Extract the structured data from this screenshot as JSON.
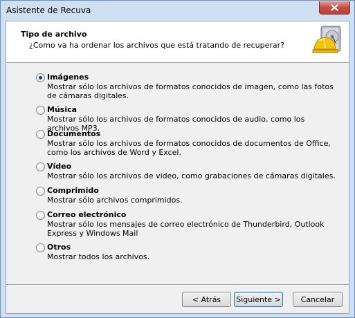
{
  "window": {
    "title": "Asistente de Recuva"
  },
  "header": {
    "title": "Tipo de archivo",
    "subtitle": "¿Como va ha ordenar los archivos que está tratando de recuperar?",
    "icon": "recuva-hard-hat-drive-icon"
  },
  "options": [
    {
      "label": "Imágenes",
      "description": "Mostrar sólo los archivos de formatos conocidos de imagen, como las fotos de cámaras digitales.",
      "checked": true
    },
    {
      "label": "Música",
      "description": "Mostrar sólo los archivos de formatos conocidos de audio, como los archivos MP3.",
      "checked": false
    },
    {
      "label": "Documentos",
      "description": "Mostrar sólo los archivos de formatos conocidos de documentos de Office, como los archivos de Word y Excel.",
      "checked": false
    },
    {
      "label": "Vídeo",
      "description": "Mostrar sólo los archivos de video, como grabaciones de cámaras digitales.",
      "checked": false
    },
    {
      "label": "Comprimido",
      "description": "Mostrar sólo archivos comprimidos.",
      "checked": false
    },
    {
      "label": "Correo electrónico",
      "description": "Mostrar sólo los mensajes de correo electrónico de Thunderbird, Outlook Express y Windows Mail",
      "checked": false
    },
    {
      "label": "Otros",
      "description": "Mostrar todos los archivos.",
      "checked": false
    }
  ],
  "buttons": {
    "back": "< Atrás",
    "next": "Siguiente >",
    "cancel": "Cancelar"
  },
  "colors": {
    "frame": "#cfe0f3",
    "close_button": "#c75050",
    "default_button_border": "#3c7fb1"
  }
}
